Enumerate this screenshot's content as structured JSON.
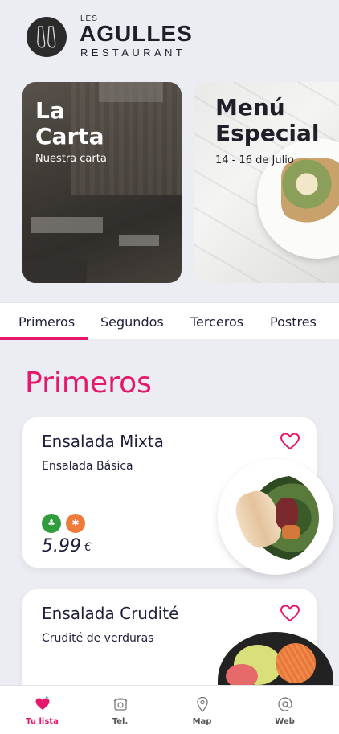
{
  "brand": {
    "small": "LES",
    "name": "AGULLES",
    "tagline": "RESTAURANT"
  },
  "carousel": [
    {
      "title_line1": "La",
      "title_line2": "Carta",
      "subtitle": "Nuestra carta"
    },
    {
      "title_line1": "Menú",
      "title_line2": "Especial",
      "subtitle": "14 - 16 de Julio"
    }
  ],
  "tabs": [
    "Primeros",
    "Segundos",
    "Terceros",
    "Postres"
  ],
  "active_tab": "Primeros",
  "section_title": "Primeros",
  "dishes": [
    {
      "name": "Ensalada Mixta",
      "description": "Ensalada Básica",
      "price": "5.99",
      "currency": "€",
      "badges": [
        "vegan-icon",
        "gluten-free-icon"
      ]
    },
    {
      "name": "Ensalada Crudité",
      "description": "Crudité de verduras"
    }
  ],
  "bottom_nav": [
    {
      "label": "Tu lista",
      "icon": "heart-icon",
      "active": true
    },
    {
      "label": "Tel.",
      "icon": "phone-icon",
      "active": false
    },
    {
      "label": "Map",
      "icon": "map-pin-icon",
      "active": false
    },
    {
      "label": "Web",
      "icon": "at-icon",
      "active": false
    }
  ],
  "colors": {
    "accent": "#e6186c",
    "text": "#1f1f3a",
    "background": "#ecedf3"
  }
}
